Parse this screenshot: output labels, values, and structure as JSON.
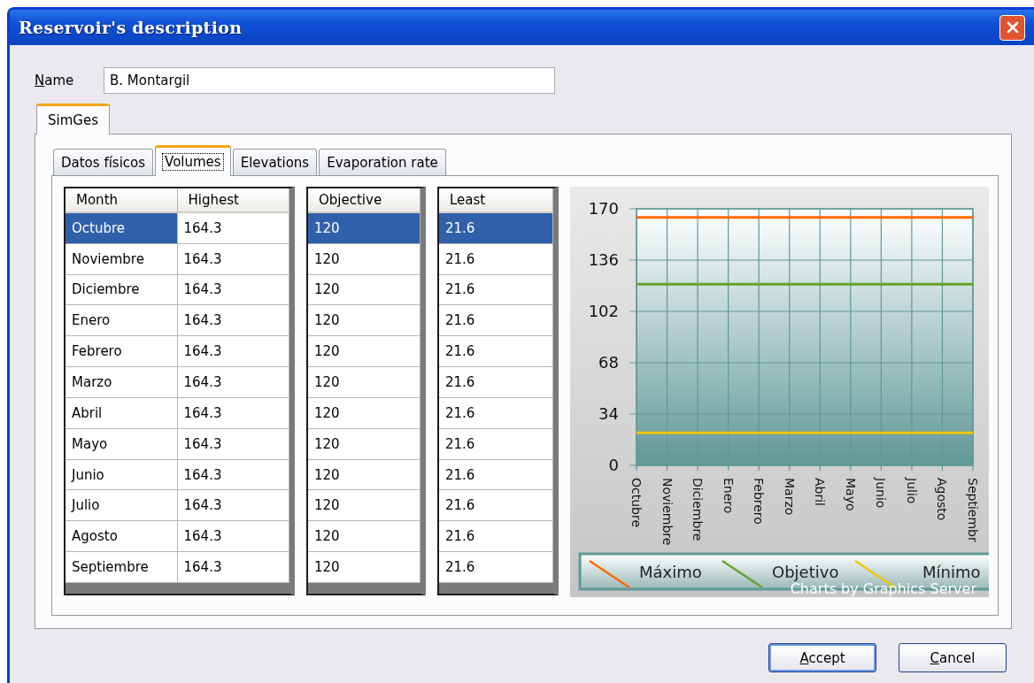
{
  "window": {
    "title": "Reservoir's description"
  },
  "name_field": {
    "label": "Name",
    "value": "B. Montargil"
  },
  "outer_tabs": [
    {
      "label": "SimGes",
      "selected": true
    }
  ],
  "inner_tabs": [
    {
      "label": "Datos físicos",
      "selected": false
    },
    {
      "label": "Volumes",
      "selected": true
    },
    {
      "label": "Elevations",
      "selected": false
    },
    {
      "label": "Evaporation rate",
      "selected": false
    }
  ],
  "grids": [
    {
      "columns": [
        "Month",
        "Highest"
      ],
      "rows": [
        {
          "cells": [
            "Octubre",
            "164.3"
          ],
          "selected": true
        },
        {
          "cells": [
            "Noviembre",
            "164.3"
          ],
          "selected": false
        },
        {
          "cells": [
            "Diciembre",
            "164.3"
          ],
          "selected": false
        },
        {
          "cells": [
            "Enero",
            "164.3"
          ],
          "selected": false
        },
        {
          "cells": [
            "Febrero",
            "164.3"
          ],
          "selected": false
        },
        {
          "cells": [
            "Marzo",
            "164.3"
          ],
          "selected": false
        },
        {
          "cells": [
            "Abril",
            "164.3"
          ],
          "selected": false
        },
        {
          "cells": [
            "Mayo",
            "164.3"
          ],
          "selected": false
        },
        {
          "cells": [
            "Junio",
            "164.3"
          ],
          "selected": false
        },
        {
          "cells": [
            "Julio",
            "164.3"
          ],
          "selected": false
        },
        {
          "cells": [
            "Agosto",
            "164.3"
          ],
          "selected": false
        },
        {
          "cells": [
            "Septiembre",
            "164.3"
          ],
          "selected": false
        }
      ]
    },
    {
      "columns": [
        "Objective"
      ],
      "rows": [
        {
          "cells": [
            "120"
          ],
          "selected": true
        },
        {
          "cells": [
            "120"
          ],
          "selected": false
        },
        {
          "cells": [
            "120"
          ],
          "selected": false
        },
        {
          "cells": [
            "120"
          ],
          "selected": false
        },
        {
          "cells": [
            "120"
          ],
          "selected": false
        },
        {
          "cells": [
            "120"
          ],
          "selected": false
        },
        {
          "cells": [
            "120"
          ],
          "selected": false
        },
        {
          "cells": [
            "120"
          ],
          "selected": false
        },
        {
          "cells": [
            "120"
          ],
          "selected": false
        },
        {
          "cells": [
            "120"
          ],
          "selected": false
        },
        {
          "cells": [
            "120"
          ],
          "selected": false
        },
        {
          "cells": [
            "120"
          ],
          "selected": false
        }
      ]
    },
    {
      "columns": [
        "Least"
      ],
      "rows": [
        {
          "cells": [
            "21.6"
          ],
          "selected": true
        },
        {
          "cells": [
            "21.6"
          ],
          "selected": false
        },
        {
          "cells": [
            "21.6"
          ],
          "selected": false
        },
        {
          "cells": [
            "21.6"
          ],
          "selected": false
        },
        {
          "cells": [
            "21.6"
          ],
          "selected": false
        },
        {
          "cells": [
            "21.6"
          ],
          "selected": false
        },
        {
          "cells": [
            "21.6"
          ],
          "selected": false
        },
        {
          "cells": [
            "21.6"
          ],
          "selected": false
        },
        {
          "cells": [
            "21.6"
          ],
          "selected": false
        },
        {
          "cells": [
            "21.6"
          ],
          "selected": false
        },
        {
          "cells": [
            "21.6"
          ],
          "selected": false
        },
        {
          "cells": [
            "21.6"
          ],
          "selected": false
        }
      ]
    }
  ],
  "chart": {
    "credit": "Charts by Graphics Server",
    "chart_data": {
      "type": "line",
      "categories": [
        "Octubre",
        "Noviembre",
        "Diciembre",
        "Enero",
        "Febrero",
        "Marzo",
        "Abril",
        "Mayo",
        "Junio",
        "Julio",
        "Agosto",
        "Septiembr"
      ],
      "series": [
        {
          "name": "Máximo",
          "color": "#ff6a00",
          "values": [
            164.3,
            164.3,
            164.3,
            164.3,
            164.3,
            164.3,
            164.3,
            164.3,
            164.3,
            164.3,
            164.3,
            164.3
          ]
        },
        {
          "name": "Objetivo",
          "color": "#66a32e",
          "values": [
            120,
            120,
            120,
            120,
            120,
            120,
            120,
            120,
            120,
            120,
            120,
            120
          ]
        },
        {
          "name": "Mínimo",
          "color": "#f2c500",
          "values": [
            21.6,
            21.6,
            21.6,
            21.6,
            21.6,
            21.6,
            21.6,
            21.6,
            21.6,
            21.6,
            21.6,
            21.6
          ]
        }
      ],
      "ylim": [
        0,
        170
      ],
      "yticks": [
        0,
        34,
        68,
        102,
        136,
        170
      ],
      "grid": true,
      "legend": "bottom"
    }
  },
  "buttons": [
    {
      "label": "Accept",
      "default": true
    },
    {
      "label": "Cancel",
      "default": false
    }
  ]
}
